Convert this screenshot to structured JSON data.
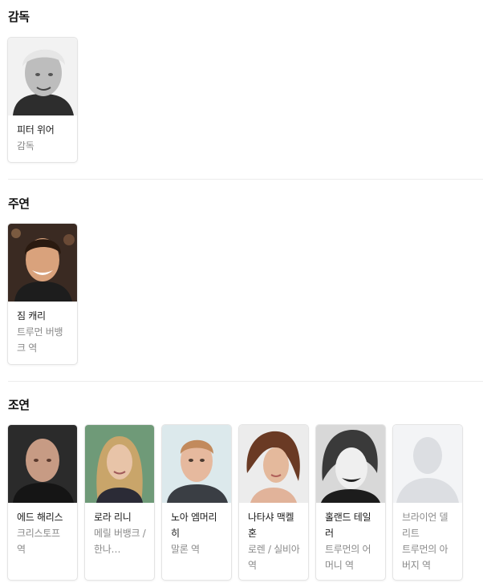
{
  "sections": {
    "director": {
      "title": "감독",
      "people": [
        {
          "name": "피터 위어",
          "role": "감독",
          "photo": "portrait-gray-hair-man"
        }
      ]
    },
    "lead": {
      "title": "주연",
      "people": [
        {
          "name": "짐 캐리",
          "role": "트루먼 버뱅크 역",
          "photo": "portrait-smiling-man"
        }
      ]
    },
    "supporting": {
      "title": "조연",
      "people": [
        {
          "name": "에드 해리스",
          "role": "크리스토프 역",
          "photo": "portrait-bald-man"
        },
        {
          "name": "로라 리니",
          "role": "메릴 버뱅크 / 한나…",
          "photo": "portrait-blonde-woman"
        },
        {
          "name": "노아 엠머리히",
          "role": "말론 역",
          "photo": "portrait-redhead-man"
        },
        {
          "name": "나타샤 맥켈혼",
          "role": "로렌 / 실비아 역",
          "photo": "portrait-brunette-woman"
        },
        {
          "name": "홀랜드 테일러",
          "role": "트루먼의 어머니 역",
          "photo": "portrait-older-woman-bw"
        },
        {
          "name": "브라이언 델리트",
          "role": "트루먼의 아버지 역",
          "photo": "placeholder-silhouette"
        }
      ]
    }
  }
}
